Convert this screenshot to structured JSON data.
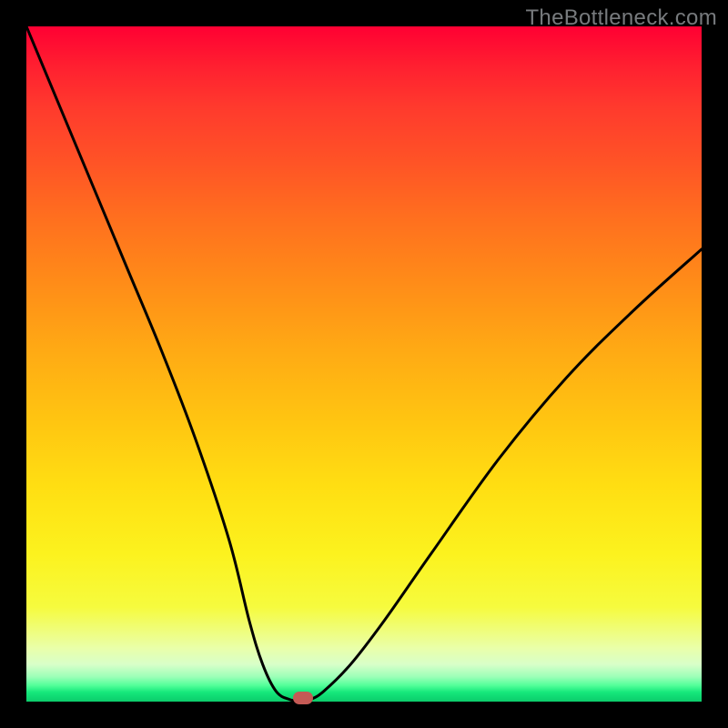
{
  "watermark": "TheBottleneck.com",
  "chart_data": {
    "type": "line",
    "title": "",
    "xlabel": "",
    "ylabel": "",
    "xlim": [
      0,
      100
    ],
    "ylim": [
      0,
      100
    ],
    "gradient_note": "vertical red→yellow→green heat background",
    "series": [
      {
        "name": "bottleneck-curve",
        "x": [
          0,
          5,
          10,
          15,
          20,
          25,
          30,
          33,
          35,
          37,
          39,
          40,
          41,
          42,
          44,
          48,
          53,
          60,
          70,
          80,
          90,
          100
        ],
        "y": [
          100,
          88,
          76,
          64,
          52,
          39,
          24,
          12,
          5.5,
          1.5,
          0.3,
          0.2,
          0.2,
          0.3,
          1.5,
          5.5,
          12,
          22,
          36,
          48,
          58,
          67
        ]
      }
    ],
    "marker": {
      "x": 41,
      "y": 0.5,
      "label": "optimal-point"
    }
  },
  "dimensions": {
    "outer": 800,
    "inner": 742,
    "inset": 29
  }
}
